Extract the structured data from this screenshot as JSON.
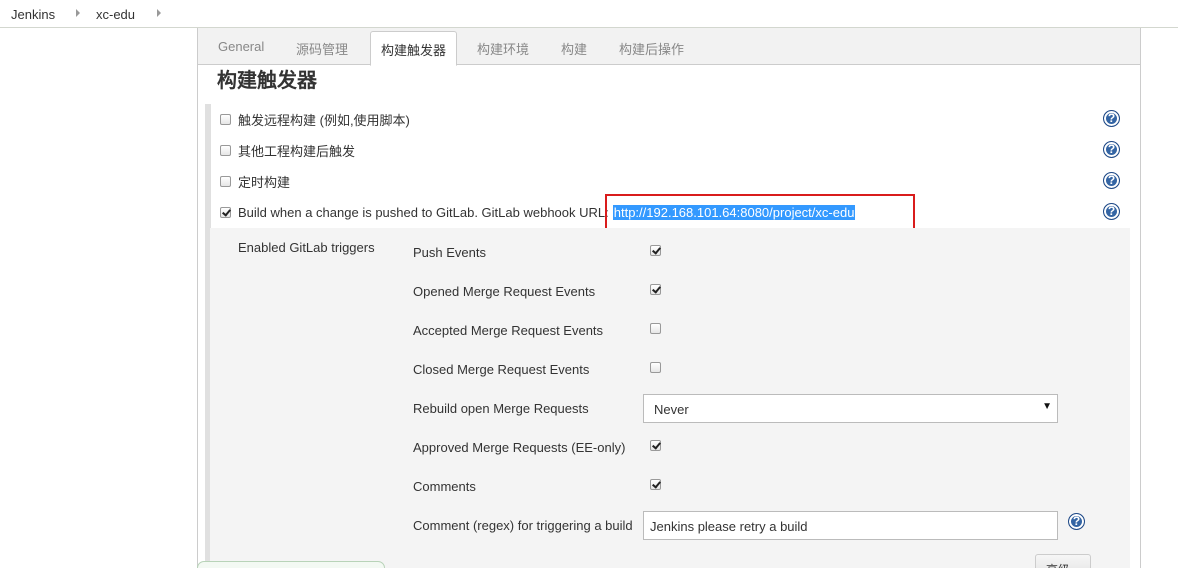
{
  "breadcrumb": {
    "items": [
      "Jenkins",
      "xc-edu"
    ]
  },
  "tabs": [
    {
      "label": "General"
    },
    {
      "label": "源码管理"
    },
    {
      "label": "构建触发器"
    },
    {
      "label": "构建环境"
    },
    {
      "label": "构建"
    },
    {
      "label": "构建后操作"
    }
  ],
  "active_tab": "构建触发器",
  "section_title": "构建触发器",
  "triggers": [
    {
      "label": "触发远程构建 (例如,使用脚本)",
      "checked": false
    },
    {
      "label": "其他工程构建后触发",
      "checked": false
    },
    {
      "label": "定时构建",
      "checked": false
    },
    {
      "label": "Build when a change is pushed to GitLab. GitLab webhook URL:",
      "checked": true
    }
  ],
  "webhook_url": "http://192.168.101.64:8080/project/xc-edu",
  "gitlab": {
    "section_label": "Enabled GitLab triggers",
    "events": [
      {
        "label": "Push Events",
        "checked": true
      },
      {
        "label": "Opened Merge Request Events",
        "checked": true
      },
      {
        "label": "Accepted Merge Request Events",
        "checked": false
      },
      {
        "label": "Closed Merge Request Events",
        "checked": false
      },
      {
        "label": "Rebuild open Merge Requests"
      },
      {
        "label": "Approved Merge Requests (EE-only)",
        "checked": true
      },
      {
        "label": "Comments",
        "checked": true
      },
      {
        "label": "Comment (regex) for triggering a build"
      }
    ],
    "rebuild_select_value": "Never",
    "comment_regex_value": "Jenkins please retry a build"
  },
  "help_icon_glyph": "?",
  "advanced_button_label": "高级...",
  "colors": {
    "help_icon": "#3465a4",
    "highlight_box": "#d91c1c",
    "selection": "#3399ff"
  }
}
